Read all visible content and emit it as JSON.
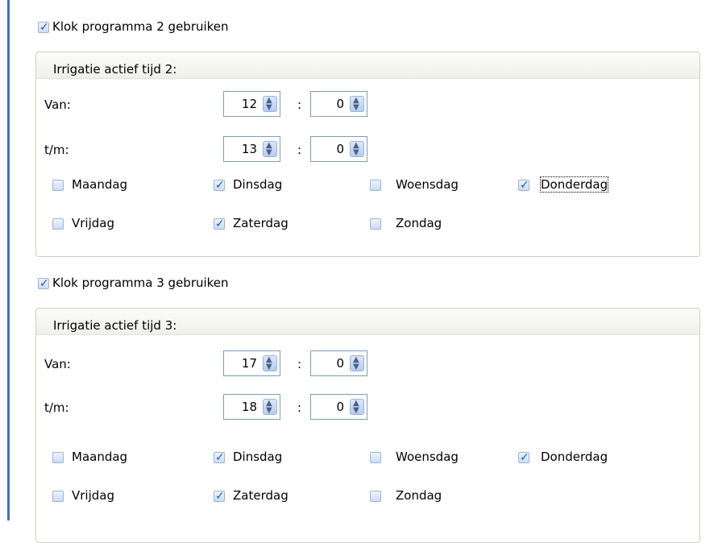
{
  "sections": [
    {
      "use_label": "Klok programma 2 gebruiken",
      "use_checked": true,
      "group_title": "Irrigatie actief tijd 2:",
      "from_label": "Van:",
      "from_hour": "12",
      "from_min": "0",
      "to_label": "t/m:",
      "to_hour": "13",
      "to_min": "0",
      "days": [
        {
          "label": "Maandag",
          "checked": false
        },
        {
          "label": "Dinsdag",
          "checked": true
        },
        {
          "label": "Woensdag",
          "checked": false
        },
        {
          "label": "Donderdag",
          "checked": true
        },
        {
          "label": "Vrijdag",
          "checked": false
        },
        {
          "label": "Zaterdag",
          "checked": true
        },
        {
          "label": "Zondag",
          "checked": false
        }
      ]
    },
    {
      "use_label": "Klok programma 3 gebruiken",
      "use_checked": true,
      "group_title": "Irrigatie actief tijd 3:",
      "from_label": "Van:",
      "from_hour": "17",
      "from_min": "0",
      "to_label": "t/m:",
      "to_hour": "18",
      "to_min": "0",
      "days": [
        {
          "label": "Maandag",
          "checked": false
        },
        {
          "label": "Dinsdag",
          "checked": true
        },
        {
          "label": "Woensdag",
          "checked": false
        },
        {
          "label": "Donderdag",
          "checked": true
        },
        {
          "label": "Vrijdag",
          "checked": false
        },
        {
          "label": "Zaterdag",
          "checked": true
        },
        {
          "label": "Zondag",
          "checked": false
        }
      ]
    }
  ],
  "colon": ":",
  "icons": {
    "checkmark": "checkmark-icon",
    "spinner": "spin-arrows-icon"
  },
  "colors": {
    "accent": "#3d6fd1",
    "checkbox_tick": "#2157b8"
  }
}
